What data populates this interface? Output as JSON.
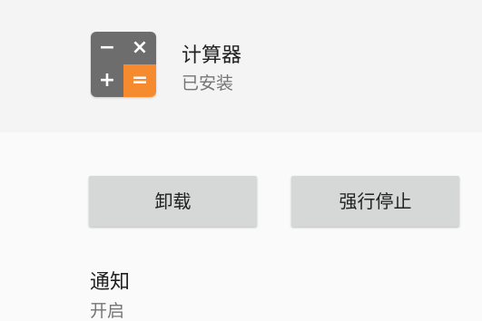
{
  "app": {
    "name": "计算器",
    "status": "已安装",
    "icon": {
      "name": "calculator-icon",
      "keys": [
        "−",
        "×",
        "+",
        "="
      ],
      "colors": {
        "key_gray": "#6d6d6d",
        "key_accent": "#f58b2e"
      }
    }
  },
  "actions": {
    "uninstall_label": "卸载",
    "force_stop_label": "强行停止"
  },
  "notifications": {
    "title": "通知",
    "summary": "开启"
  }
}
